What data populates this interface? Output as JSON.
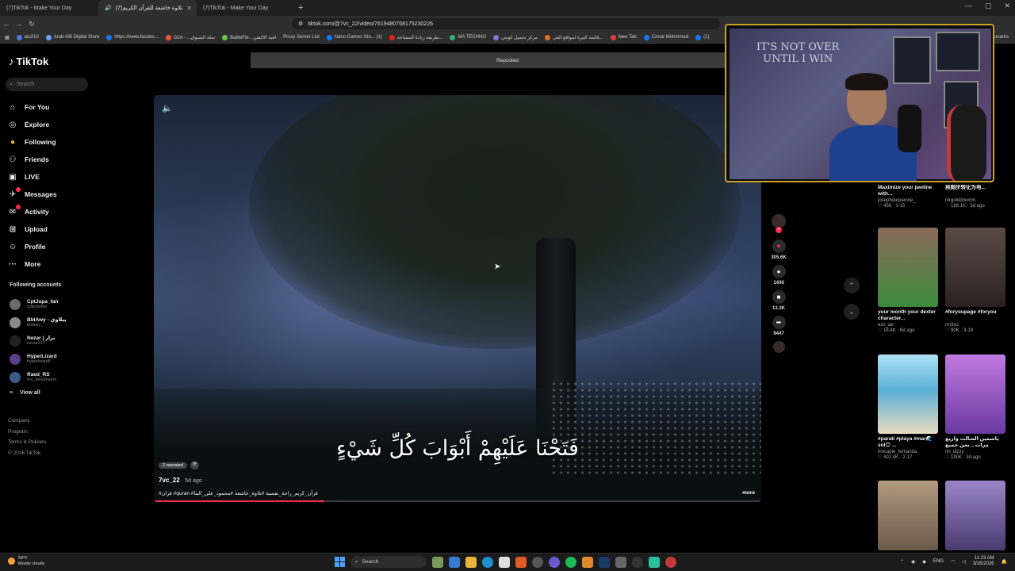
{
  "browser": {
    "tabs": [
      {
        "title": "(7)TikTok - Make Your Day",
        "active": false
      },
      {
        "title": "(7)تلاوة خاشعة للقرآن الكريم",
        "active": true
      },
      {
        "title": "(7)TikTok - Make Your Day",
        "active": false
      }
    ],
    "new_tab": "+",
    "window_controls": [
      "—",
      "▢",
      "✕"
    ],
    "url": "tiktok.com/@7vc_22/video/7619480768175230226",
    "bookmarks": [
      "aio210",
      "Arab-GB Digital Store",
      "https://www.facebo...",
      "G2A - ...سلة التسوق",
      "BattleFie...لعبة الاكشن",
      "Proxy Server List",
      "Nano Games Sto... (1)",
      "طريقة زيادة المساحة...",
      "MA TECHNO",
      "مركز تحميل كونتي",
      "قائمة كثيرة لمواقع الفي...",
      "New Tab",
      "Címar Mohmmed",
      "(1)"
    ],
    "bookmarks_end": "Bookmarks"
  },
  "sidebar": {
    "logo": "TikTok",
    "search_placeholder": "Search",
    "nav": [
      {
        "label": "For You",
        "icon": "home-icon",
        "glyph": "⌂"
      },
      {
        "label": "Explore",
        "icon": "compass-icon",
        "glyph": "◎"
      },
      {
        "label": "Following",
        "icon": "following-icon",
        "glyph": "●"
      },
      {
        "label": "Friends",
        "icon": "friends-icon",
        "glyph": "⚇"
      },
      {
        "label": "LIVE",
        "icon": "live-icon",
        "glyph": "▣"
      },
      {
        "label": "Messages",
        "icon": "messages-icon",
        "glyph": "✈"
      },
      {
        "label": "Activity",
        "icon": "activity-icon",
        "glyph": "✉"
      },
      {
        "label": "Upload",
        "icon": "upload-icon",
        "glyph": "⊞"
      },
      {
        "label": "Profile",
        "icon": "profile-icon",
        "glyph": "☺"
      },
      {
        "label": "More",
        "icon": "more-icon",
        "glyph": "···"
      }
    ],
    "following_title": "Following accounts",
    "accounts": [
      {
        "name": "CptJupa_fan",
        "handle": "cptjubafan"
      },
      {
        "name": "BblAwy - بيلاوي",
        "handle": "bblawy_"
      },
      {
        "name": "Nezar | نزار",
        "handle": "nezar217"
      },
      {
        "name": "HyperLizard",
        "handle": "hyperlizard6"
      },
      {
        "name": "Raed_RS",
        "handle": "mo_ibraSheem"
      }
    ],
    "view_all": "View all",
    "footer": [
      "Company",
      "Program",
      "Terms & Policies",
      "© 2026 TikTok"
    ]
  },
  "video": {
    "banner": "Reposted",
    "caption_ar": "فَتَحْنَا عَلَيْهِمْ أَبْوَابَ كُلِّ شَيْءٍ",
    "reposted": "2 reposted",
    "author": "7vc_22",
    "date": "· 5d ago",
    "tags": "#قران #quran #قرآن_كريم_راحة_نفسية #تلاوة_خاشعة #محمود_علي_البنا",
    "more": "more",
    "progress": 0.28
  },
  "actions": [
    {
      "name": "like",
      "icon": "heart-icon",
      "glyph": "♥",
      "count": "305.6K",
      "color": "#fe2c55"
    },
    {
      "name": "comment",
      "icon": "comment-icon",
      "glyph": "●",
      "count": "1408",
      "color": "#ffffff"
    },
    {
      "name": "save",
      "icon": "bookmark-icon",
      "glyph": "■",
      "count": "13.3K",
      "color": "#ffffff"
    },
    {
      "name": "share",
      "icon": "share-icon",
      "glyph": "➦",
      "count": "9447",
      "color": "#ffffff"
    }
  ],
  "webcam": {
    "poster_line1": "IT'S NOT OVER",
    "poster_line2": "UNTIL I WIN"
  },
  "feed": [
    {
      "title": "Maximize your jawline with...",
      "user": "josephduquenne_",
      "meta": "♡ 456 · 1-15",
      "color": "#3a3a3a"
    },
    {
      "title": "将脚步转化为电...",
      "user": "mrgolddoomm",
      "meta": "♡ 188.1K · 3d ago",
      "color": "#3a3a3a"
    },
    {
      "title": "your month your dexter character...",
      "user": "ezo_ae",
      "meta": "♡ 18.4K · 6d ago",
      "color": "#7a4a3a"
    },
    {
      "title": "#foryoupage #foryou",
      "user": "rm3so",
      "meta": "♡ 90K · 3-18",
      "color": "#4a3a35"
    },
    {
      "title": "#parati #playa #mar🌊sol😊 ...",
      "user": "hincapie_fernanda",
      "meta": "♡ 402.4K · 2-17",
      "color": "#6fb6d8"
    },
    {
      "title": "ياسمين الشالت وازيع مرات... بمن جميع الحقوق محفوظة",
      "user": "riri_dizzy",
      "meta": "♡ 190K · 3d ago",
      "color": "#b06ad0"
    },
    {
      "title": "",
      "user": "",
      "meta": "",
      "color": "#8a7560"
    },
    {
      "title": "",
      "user": "",
      "meta": "",
      "color": "#8c6fb0"
    }
  ],
  "taskbar": {
    "weather_temp": "59°F",
    "weather_desc": "Mostly cloudy",
    "search": "Search",
    "lang": "ENG",
    "time": "11:23 AM",
    "date": "3/26/2026"
  }
}
